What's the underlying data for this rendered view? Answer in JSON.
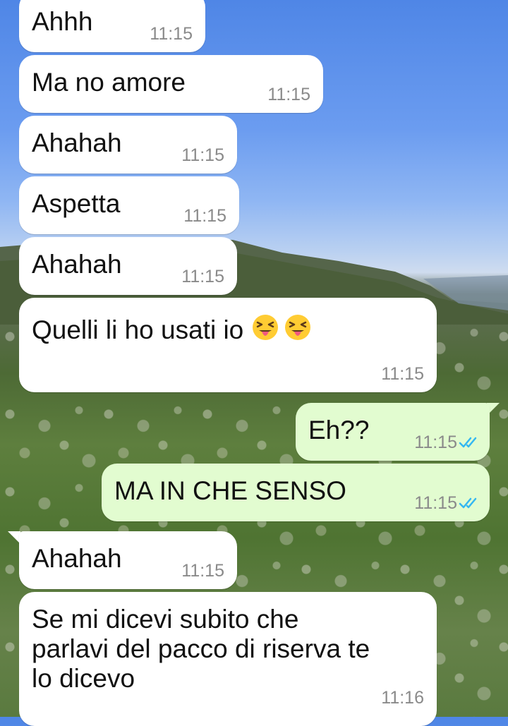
{
  "messages": [
    {
      "direction": "incoming",
      "text": "Ahhh",
      "time": "11:15"
    },
    {
      "direction": "incoming",
      "text": "Ma no amore",
      "time": "11:15"
    },
    {
      "direction": "incoming",
      "text": "Ahahah",
      "time": "11:15"
    },
    {
      "direction": "incoming",
      "text": "Aspetta",
      "time": "11:15"
    },
    {
      "direction": "incoming",
      "text": "Ahahah",
      "time": "11:15"
    },
    {
      "direction": "incoming",
      "text": "Quelli li ho usati io",
      "emoji": [
        "squinting-face-with-tongue",
        "squinting-face-with-tongue"
      ],
      "time": "11:15"
    },
    {
      "direction": "outgoing",
      "text": "Eh??",
      "time": "11:15",
      "status": "read"
    },
    {
      "direction": "outgoing",
      "text": "MA IN CHE SENSO",
      "time": "11:15",
      "status": "read"
    },
    {
      "direction": "incoming",
      "text": "Ahahah",
      "time": "11:15"
    },
    {
      "direction": "incoming",
      "text": "Se mi dicevi subito che\nparlavi del pacco di riserva te\nlo dicevo",
      "time": "11:16"
    }
  ],
  "colors": {
    "incoming_bubble": "#ffffff",
    "outgoing_bubble": "#e2fcd0",
    "read_ticks": "#34b7f1",
    "timestamp": "#8a8a8a"
  },
  "icons": {
    "read_receipt": "double-check-icon",
    "emoji": "squinting-face-with-tongue"
  }
}
